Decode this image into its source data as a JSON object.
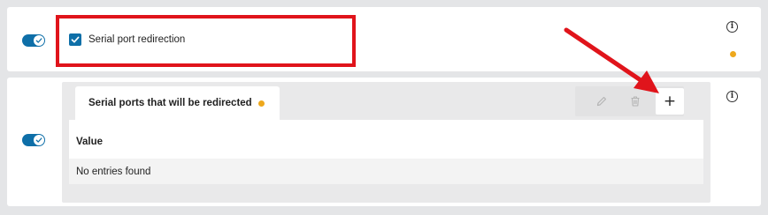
{
  "serial_redirection": {
    "checkbox_label": "Serial port redirection",
    "checked": true,
    "enabled": true
  },
  "serial_ports": {
    "tab_label": "Serial ports that will be redirected",
    "enabled": true,
    "table": {
      "columns": [
        "Value"
      ],
      "rows": [],
      "empty_text": "No entries found"
    }
  },
  "icons": {
    "info": "i",
    "add": "+"
  },
  "colors": {
    "accent": "#0e6fa8",
    "status_dot": "#eea81c",
    "annotation": "#e0141b",
    "background": "#e4e5e7"
  }
}
